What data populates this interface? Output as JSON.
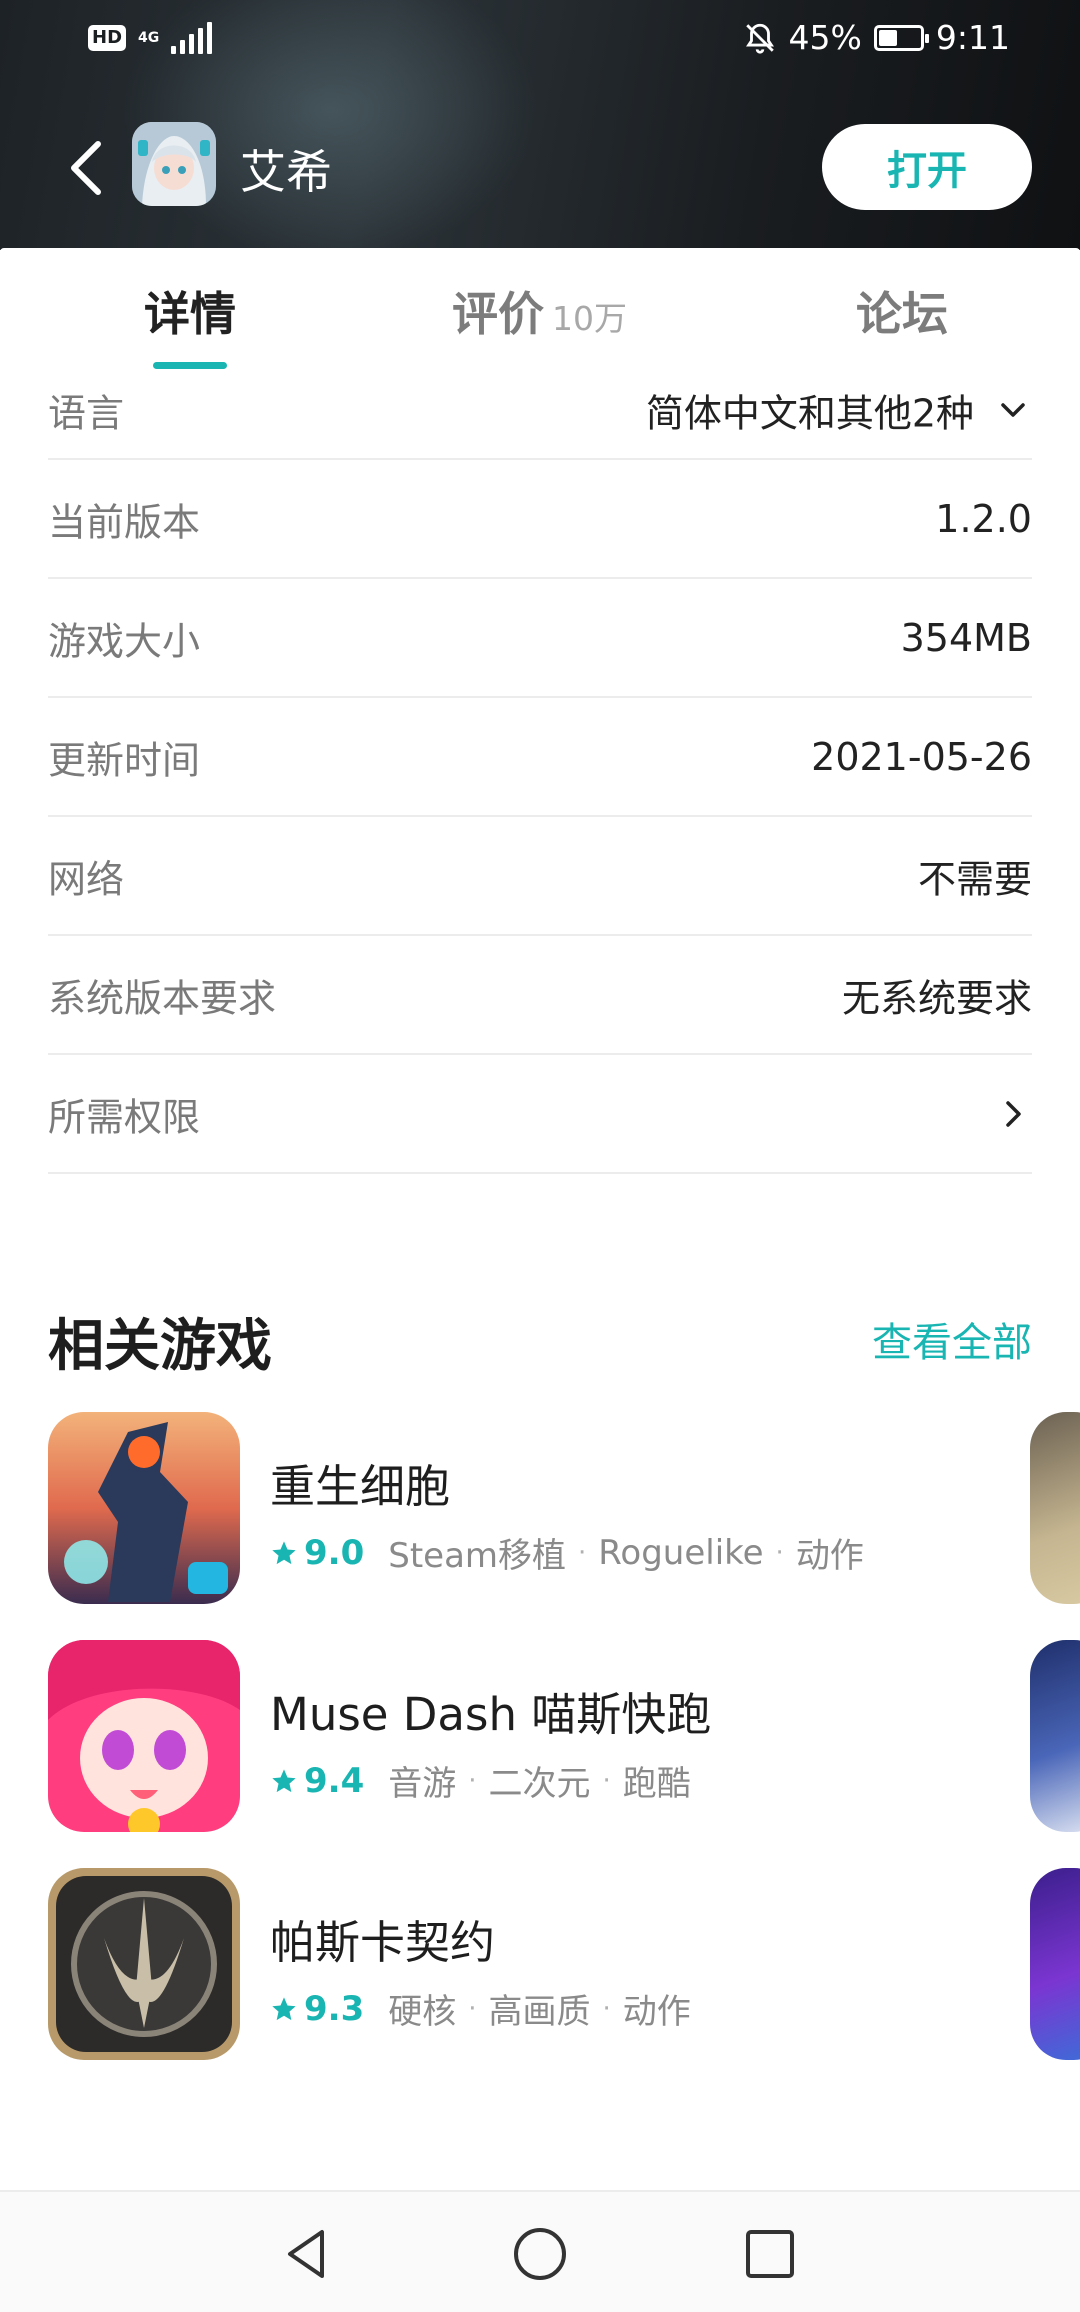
{
  "status_bar": {
    "hd": "HD",
    "network": "4G",
    "battery_percent": "45%",
    "battery_level": 0.45,
    "time": "9:11"
  },
  "app": {
    "title": "艾希",
    "open_label": "打开"
  },
  "tabs": [
    {
      "label": "详情",
      "count": "",
      "active": true
    },
    {
      "label": "评价",
      "count": "10万",
      "active": false
    },
    {
      "label": "论坛",
      "count": "",
      "active": false
    }
  ],
  "info_rows": [
    {
      "label": "语言",
      "value": "简体中文和其他2种",
      "icon": "chevron-down-icon"
    },
    {
      "label": "当前版本",
      "value": "1.2.0"
    },
    {
      "label": "游戏大小",
      "value": "354MB"
    },
    {
      "label": "更新时间",
      "value": "2021-05-26"
    },
    {
      "label": "网络",
      "value": "不需要"
    },
    {
      "label": "系统版本要求",
      "value": "无系统要求"
    },
    {
      "label": "所需权限",
      "value": "",
      "icon": "chevron-right-icon"
    }
  ],
  "related": {
    "title": "相关游戏",
    "see_all": "查看全部",
    "games": [
      {
        "name": "重生细胞",
        "score": "9.0",
        "tags": [
          "Steam移植",
          "Roguelike",
          "动作"
        ]
      },
      {
        "name": "Muse Dash 喵斯快跑",
        "score": "9.4",
        "tags": [
          "音游",
          "二次元",
          "跑酷"
        ]
      },
      {
        "name": "帕斯卡契约",
        "score": "9.3",
        "tags": [
          "硬核",
          "高画质",
          "动作"
        ]
      }
    ]
  },
  "colors": {
    "accent": "#19b5b2",
    "header_dark": "#1d2226",
    "text_primary": "#222222",
    "text_secondary": "#7a7a7a"
  },
  "nav": {
    "back": "nav-back-icon",
    "home": "nav-home-icon",
    "recents": "nav-recents-icon"
  }
}
